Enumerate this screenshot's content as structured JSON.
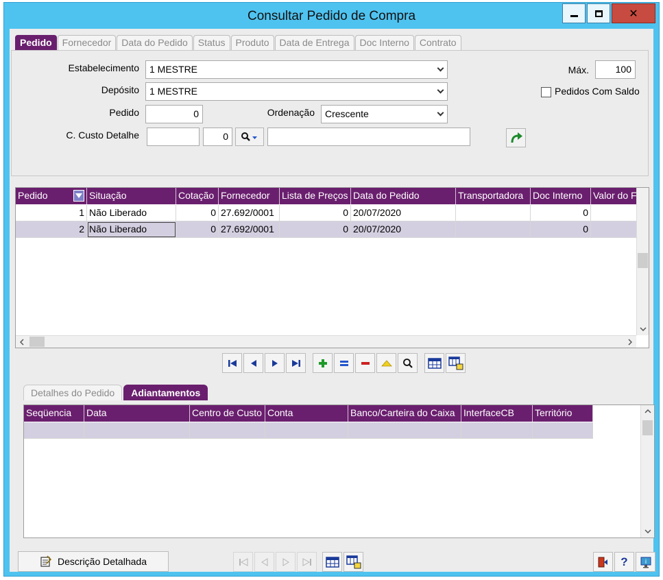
{
  "window": {
    "title": "Consultar Pedido de Compra",
    "close_glyph": "✕"
  },
  "top_tabs": [
    {
      "label": "Pedido",
      "active": true
    },
    {
      "label": "Fornecedor"
    },
    {
      "label": "Data do Pedido"
    },
    {
      "label": "Status"
    },
    {
      "label": "Produto"
    },
    {
      "label": "Data de Entrega"
    },
    {
      "label": "Doc Interno"
    },
    {
      "label": "Contrato"
    }
  ],
  "filters": {
    "estabelecimento_label": "Estabelecimento",
    "estabelecimento_value": "1 MESTRE",
    "deposito_label": "Depósito",
    "deposito_value": "1 MESTRE",
    "pedido_label": "Pedido",
    "pedido_value": "0",
    "ordenacao_label": "Ordenação",
    "ordenacao_value": "Crescente",
    "custo_label": "C. Custo Detalhe",
    "custo_value_a": "",
    "custo_value_b": "0",
    "custo_desc": "",
    "max_label": "Máx.",
    "max_value": "100",
    "pedidos_saldo_label": "Pedidos Com Saldo",
    "pedidos_saldo_checked": false
  },
  "grid": {
    "columns": [
      "Pedido",
      "Situação",
      "Cotação",
      "Fornecedor",
      "Lista de Preços",
      "Data do Pedido",
      "Transportadora",
      "Doc Interno",
      "Valor do F"
    ],
    "rows": [
      [
        "1",
        "Não Liberado",
        "0",
        "27.692/0001",
        "0",
        "20/07/2020",
        "",
        "0",
        ""
      ],
      [
        "2",
        "Não Liberado",
        "0",
        "27.692/0001",
        "0",
        "20/07/2020",
        "",
        "0",
        ""
      ]
    ],
    "selected_row": 1
  },
  "bottom_tabs": [
    {
      "label": "Detalhes do Pedido"
    },
    {
      "label": "Adiantamentos",
      "active": true
    }
  ],
  "grid2": {
    "columns": [
      "Seqüencia",
      "Data",
      "Centro de Custo",
      "Conta",
      "Banco/Carteira do Caixa",
      "InterfaceCB",
      "Território"
    ]
  },
  "footer": {
    "descricao_label": "Descrição Detalhada",
    "help_glyph": "?"
  },
  "colors": {
    "accent": "#6a1f6e",
    "selection": "#d4cfe0",
    "frame": "#4fc3f0"
  }
}
